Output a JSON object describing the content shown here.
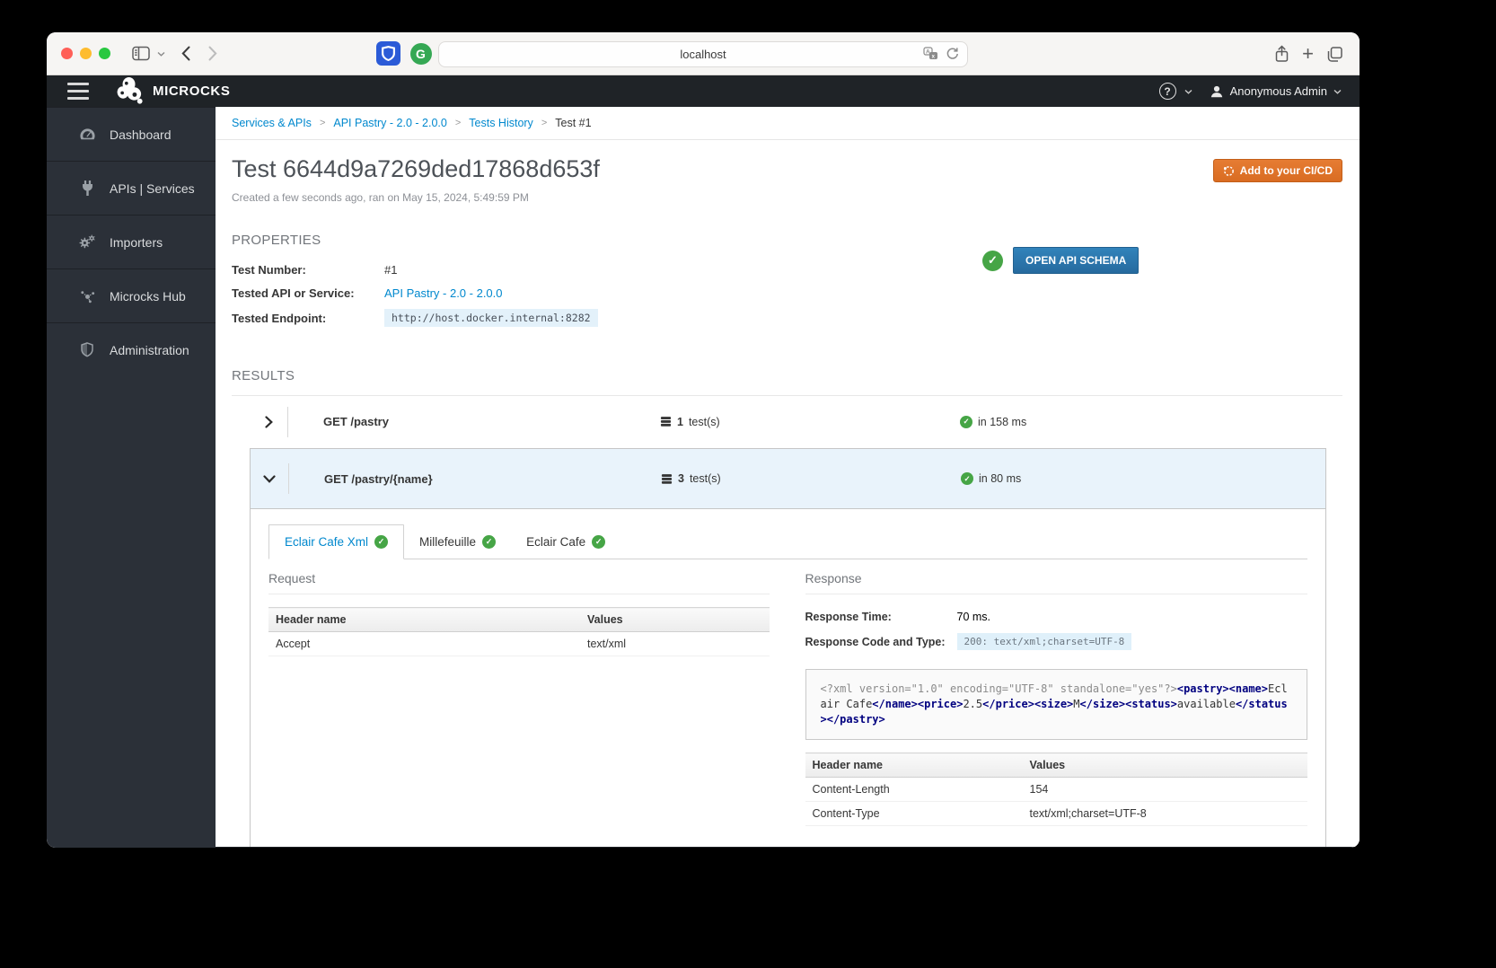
{
  "browser": {
    "url": "localhost"
  },
  "header": {
    "brand": "MICROCKS",
    "user": "Anonymous Admin"
  },
  "sidebar": {
    "items": [
      {
        "label": "Dashboard"
      },
      {
        "label": "APIs | Services"
      },
      {
        "label": "Importers"
      },
      {
        "label": "Microcks Hub"
      },
      {
        "label": "Administration"
      }
    ]
  },
  "breadcrumb": {
    "items": [
      "Services & APIs",
      "API Pastry - 2.0 - 2.0.0",
      "Tests History",
      "Test #1"
    ]
  },
  "page": {
    "title": "Test 6644d9a7269ded17868d653f",
    "subtitle": "Created a few seconds ago, ran on May 15, 2024, 5:49:59 PM",
    "cicd_label": "Add to your CI/CD"
  },
  "properties": {
    "heading": "PROPERTIES",
    "test_number_label": "Test Number:",
    "test_number_value": "#1",
    "service_label": "Tested API or Service:",
    "service_value": "API Pastry - 2.0 - 2.0.0",
    "endpoint_label": "Tested Endpoint:",
    "endpoint_value": "http://host.docker.internal:8282",
    "open_schema_label": "OPEN API SCHEMA"
  },
  "results": {
    "heading": "RESULTS",
    "op1": {
      "name": "GET /pastry",
      "tests_count": "1",
      "tests_suffix": "test(s)",
      "time": "in 158 ms"
    },
    "op2": {
      "name": "GET /pastry/{name}",
      "tests_count": "3",
      "tests_suffix": "test(s)",
      "time": "in 80 ms"
    },
    "tabs": [
      {
        "label": "Eclair Cafe Xml"
      },
      {
        "label": "Millefeuille"
      },
      {
        "label": "Eclair Cafe"
      }
    ],
    "request": {
      "heading": "Request",
      "col_header": "Header name",
      "col_values": "Values",
      "rows": [
        {
          "name": "Accept",
          "value": "text/xml"
        }
      ]
    },
    "response": {
      "heading": "Response",
      "time_label": "Response Time:",
      "time_value": "70 ms.",
      "code_label": "Response Code and Type:",
      "code_value": "200: text/xml;charset=UTF-8",
      "payload": {
        "prolog": "<?xml version=\"1.0\" encoding=\"UTF-8\" standalone=\"yes\"?>",
        "seg1_tag": "<pastry><name>",
        "seg1_text": "Eclair Cafe",
        "seg2_tag": "</name><price>",
        "seg2_text": "2.5",
        "seg3_tag": "</price><size>",
        "seg3_text": "M",
        "seg4_tag": "</size><status>",
        "seg4_text": "available",
        "seg5_tag": "</status></pastry>"
      },
      "col_header": "Header name",
      "col_values": "Values",
      "rows": [
        {
          "name": "Content-Length",
          "value": "154"
        },
        {
          "name": "Content-Type",
          "value": "text/xml;charset=UTF-8"
        }
      ]
    }
  },
  "colors": {
    "accent_blue": "#0088ce",
    "success_green": "#46a546",
    "cicd_orange": "#df702b",
    "top_border_blue": "#3f9fd4"
  }
}
